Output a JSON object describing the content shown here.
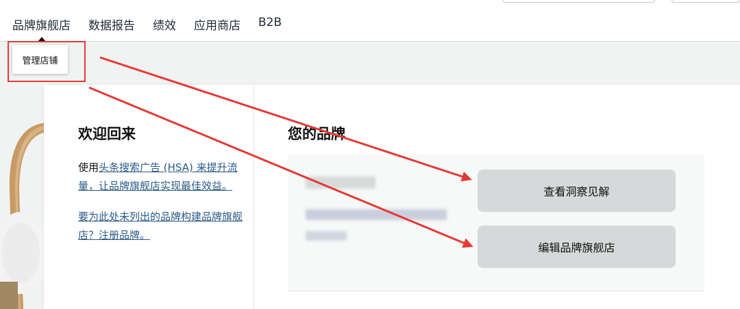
{
  "nav": {
    "items": [
      {
        "label": "品牌旗舰店",
        "active": true
      },
      {
        "label": "数据报告"
      },
      {
        "label": "绩效"
      },
      {
        "label": "应用商店"
      },
      {
        "label": "B2B"
      }
    ]
  },
  "dropdown": {
    "label": "管理店铺"
  },
  "welcome": {
    "title": "欢迎回来",
    "p1_prefix": "使用",
    "p1_link": "头条搜索广告 (HSA) 来提升流量，让品牌旗舰店实现最佳效益。",
    "p2_link": "要为此处未列出的品牌构建品牌旗舰店？注册品牌。"
  },
  "brand": {
    "title": "您的品牌",
    "insights_button": "查看洞察见解",
    "edit_button": "编辑品牌旗舰店"
  },
  "colors": {
    "annotation": "#e53935",
    "link": "#2a5a86",
    "button_bg": "#d6d9d9"
  }
}
